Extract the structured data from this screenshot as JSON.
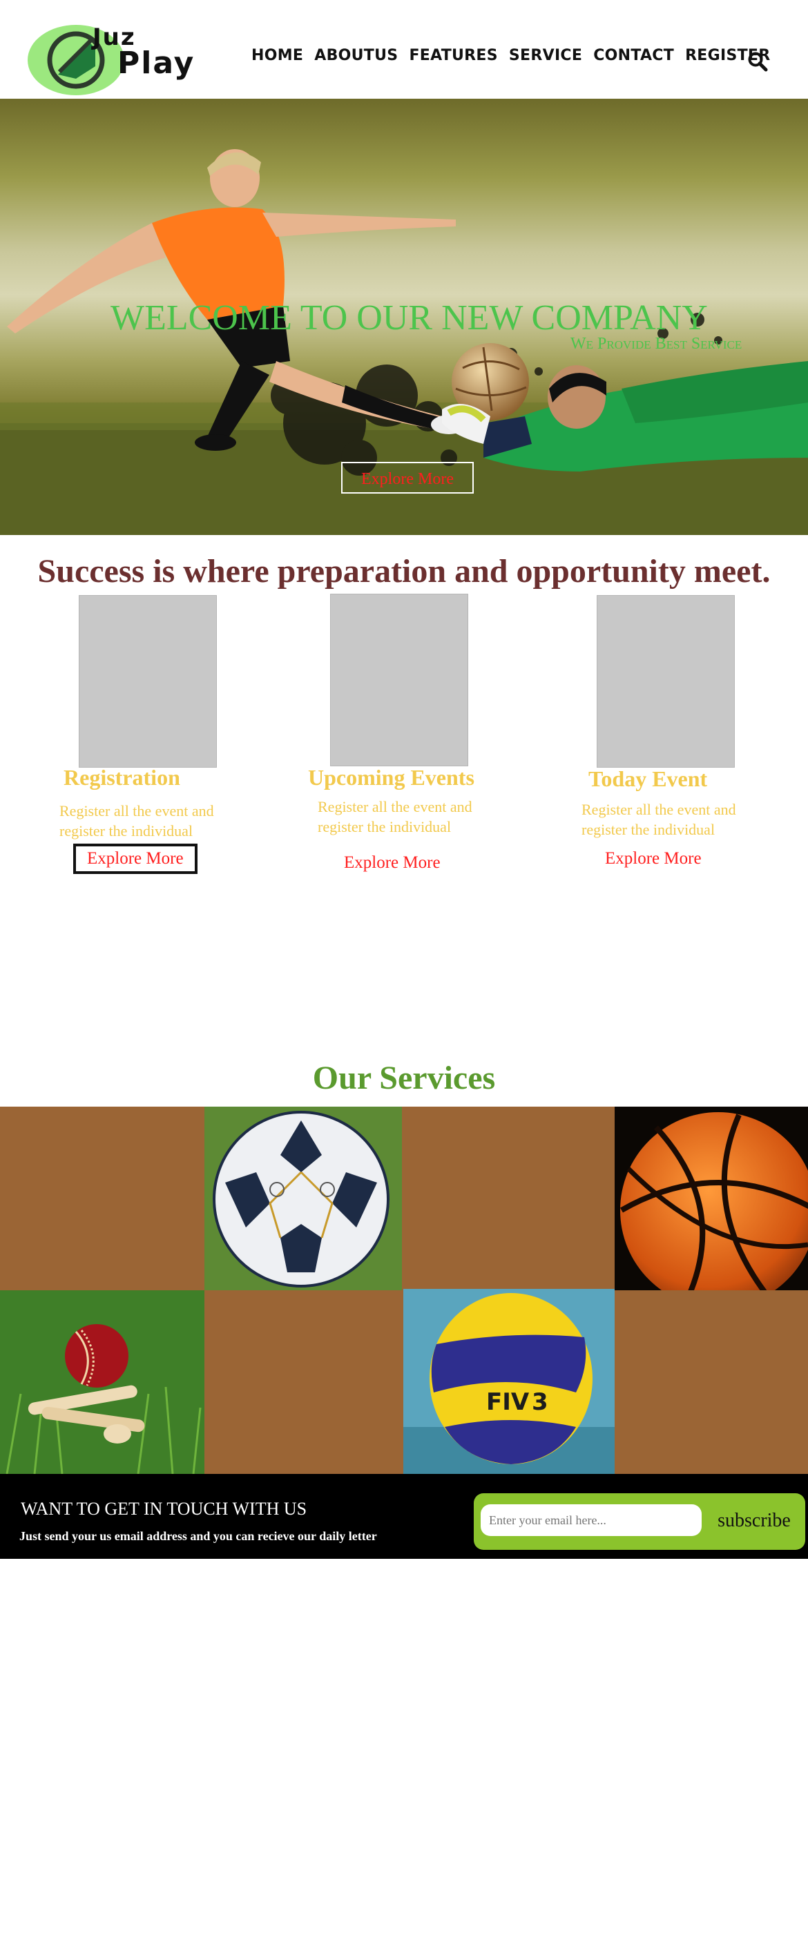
{
  "header": {
    "logo_line1": "Juz",
    "logo_line2": "Play",
    "nav": [
      "HOME",
      "ABOUTUS",
      "FEATURES",
      "SERVICE",
      "CONTACT",
      "REGISTER"
    ]
  },
  "hero": {
    "title": "WELCOME TO OUR NEW COMPANY",
    "subtitle": "We Provide Best Service",
    "button": "Explore More"
  },
  "quote": "Success is where preparation and opportunity meet.",
  "cards": [
    {
      "title": "Registration",
      "text": "Register all the event and register the individual",
      "link": "Explore More"
    },
    {
      "title": "Upcoming Events",
      "text": "Register all the event and register the individual",
      "link": "Explore More"
    },
    {
      "title": "Today Event",
      "text": "Register all the event and register the individual",
      "link": "Explore More"
    }
  ],
  "services": {
    "title": "Our Services",
    "tile_images": [
      "football-image",
      "basketball-image",
      "cricket-ball-image",
      "volleyball-image"
    ]
  },
  "subscribe": {
    "heading": "WANT TO GET IN TOUCH WITH US",
    "text": "Just send your us email address and you can recieve our daily letter",
    "placeholder": "Enter your email here...",
    "button": "subscribe"
  },
  "colors": {
    "hero_text": "#4cc44c",
    "quote": "#6b2f2f",
    "card_title": "#f2c94c",
    "link": "#ff1e1e",
    "services_title": "#5a9a2e",
    "tile_brown": "#9b6535",
    "subscribe_green": "#8bc32c"
  }
}
